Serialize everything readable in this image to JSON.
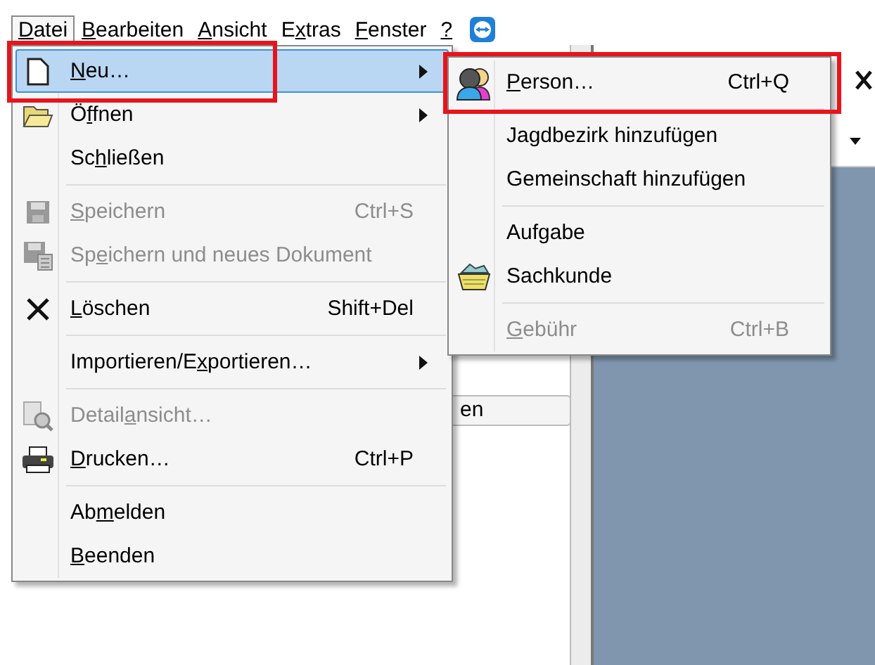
{
  "menubar": [
    {
      "label": {
        "key": "D",
        "after": "atei"
      },
      "selected": true
    },
    {
      "label": {
        "key": "B",
        "after": "earbeiten"
      },
      "selected": false
    },
    {
      "label": {
        "key": "A",
        "after": "nsicht"
      },
      "selected": false
    },
    {
      "label": {
        "before": "E",
        "key": "x",
        "after": "tras"
      },
      "selected": false
    },
    {
      "label": {
        "key": "F",
        "after": "enster"
      },
      "selected": false
    },
    {
      "label": {
        "key": "?"
      },
      "selected": false
    }
  ],
  "background": {
    "button_text": "en"
  },
  "file_menu": [
    {
      "kind": "item",
      "label": {
        "key": "N",
        "after": "eu…"
      },
      "submenu": true,
      "selected": true,
      "disabled": false,
      "marked": true
    },
    {
      "kind": "item",
      "label": {
        "before": "Ö",
        "key": "f",
        "after": "fnen"
      },
      "submenu": true,
      "selected": false,
      "disabled": false,
      "marked": false
    },
    {
      "kind": "item",
      "label": {
        "before": "Sc",
        "key": "h",
        "after": "ließen"
      },
      "submenu": false,
      "selected": false,
      "disabled": false,
      "marked": false
    },
    {
      "kind": "separator"
    },
    {
      "kind": "item",
      "label": {
        "key": "S",
        "after": "peichern"
      },
      "shortcut": "Ctrl+S",
      "submenu": false,
      "selected": false,
      "disabled": true,
      "marked": false
    },
    {
      "kind": "item",
      "label": {
        "before": "Sp",
        "key": "e",
        "after": "ichern und neues Dokument"
      },
      "submenu": false,
      "selected": false,
      "disabled": true,
      "marked": false
    },
    {
      "kind": "separator"
    },
    {
      "kind": "item",
      "label": {
        "key": "L",
        "after": "öschen"
      },
      "shortcut": "Shift+Del",
      "submenu": false,
      "selected": false,
      "disabled": false,
      "marked": false
    },
    {
      "kind": "separator"
    },
    {
      "kind": "item",
      "label": {
        "before": "Importieren/E",
        "key": "x",
        "after": "portieren…"
      },
      "submenu": true,
      "selected": false,
      "disabled": false,
      "marked": false
    },
    {
      "kind": "separator"
    },
    {
      "kind": "item",
      "label": {
        "before": "Detail",
        "key": "a",
        "after": "nsicht…"
      },
      "submenu": false,
      "selected": false,
      "disabled": true,
      "marked": false
    },
    {
      "kind": "item",
      "label": {
        "key": "D",
        "after": "rucken…"
      },
      "shortcut": "Ctrl+P",
      "submenu": false,
      "selected": false,
      "disabled": false,
      "marked": false
    },
    {
      "kind": "separator"
    },
    {
      "kind": "item",
      "label": {
        "before": "Ab",
        "key": "m",
        "after": "elden"
      },
      "submenu": false,
      "selected": false,
      "disabled": false,
      "marked": false
    },
    {
      "kind": "item",
      "label": {
        "key": "B",
        "after": "eenden"
      },
      "submenu": false,
      "selected": false,
      "disabled": false,
      "marked": false
    }
  ],
  "new_submenu": [
    {
      "kind": "item",
      "label": {
        "key": "P",
        "after": "erson…"
      },
      "shortcut": "Ctrl+Q",
      "selected": false,
      "disabled": false,
      "marked": true
    },
    {
      "kind": "separator"
    },
    {
      "kind": "item",
      "label": {
        "before": "Jagdbezirk hinzufügen"
      },
      "selected": false,
      "disabled": false,
      "marked": false
    },
    {
      "kind": "item",
      "label": {
        "before": "Gemeinschaft hinzufügen"
      },
      "selected": false,
      "disabled": false,
      "marked": false
    },
    {
      "kind": "separator"
    },
    {
      "kind": "item",
      "label": {
        "before": "Aufgabe"
      },
      "selected": false,
      "disabled": false,
      "marked": false
    },
    {
      "kind": "item",
      "label": {
        "before": "Sachkunde"
      },
      "selected": false,
      "disabled": false,
      "marked": false
    },
    {
      "kind": "separator"
    },
    {
      "kind": "item",
      "label": {
        "key": "G",
        "after": "ebühr"
      },
      "shortcut": "Ctrl+B",
      "selected": false,
      "disabled": true,
      "marked": false
    }
  ]
}
